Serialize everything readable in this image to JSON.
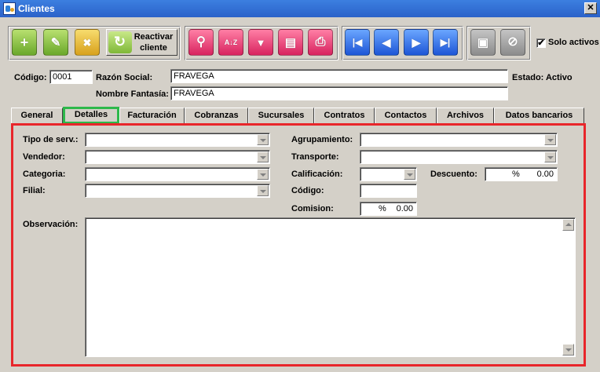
{
  "window": {
    "title": "Clientes",
    "close_glyph": "✕"
  },
  "toolbar": {
    "reactivar_label": "Reactivar cliente",
    "buttons": [
      {
        "name": "add-icon",
        "glyph": "+"
      },
      {
        "name": "edit-icon",
        "glyph": "✎"
      },
      {
        "name": "delete-icon",
        "glyph": "✖"
      },
      {
        "name": "search-icon",
        "glyph": "⚲"
      },
      {
        "name": "sort-az-icon",
        "glyph": "A↓Z"
      },
      {
        "name": "filter-icon",
        "glyph": "▼"
      },
      {
        "name": "report-icon",
        "glyph": "▤"
      },
      {
        "name": "print-icon",
        "glyph": "⎙"
      },
      {
        "name": "first-record-icon",
        "glyph": "|◀"
      },
      {
        "name": "prev-record-icon",
        "glyph": "◀"
      },
      {
        "name": "next-record-icon",
        "glyph": "▶"
      },
      {
        "name": "last-record-icon",
        "glyph": "▶|"
      },
      {
        "name": "save-icon",
        "glyph": "▣"
      },
      {
        "name": "cancel-icon",
        "glyph": "⊘"
      }
    ],
    "solo_activos_label": "Solo activos",
    "solo_activos_checked": "✔"
  },
  "header": {
    "codigo_label": "Código:",
    "codigo_value": "0001",
    "razon_social_label": "Razón Social:",
    "razon_social_value": "FRAVEGA",
    "nombre_fantasia_label": "Nombre Fantasía:",
    "nombre_fantasia_value": "FRAVEGA",
    "estado": "Estado: Activo"
  },
  "tabs": [
    "General",
    "Detalles",
    "Facturación",
    "Cobranzas",
    "Sucursales",
    "Contratos",
    "Contactos",
    "Archivos",
    "Datos bancarios"
  ],
  "active_tab": "Detalles",
  "detalles": {
    "tipo_serv_label": "Tipo de serv.:",
    "vendedor_label": "Vendedor:",
    "categoria_label": "Categoria:",
    "filial_label": "Filial:",
    "agrupamiento_label": "Agrupamiento:",
    "transporte_label": "Transporte:",
    "calificacion_label": "Calificación:",
    "descuento_label": "Descuento:",
    "descuento_symbol": "%",
    "descuento_value": "0.00",
    "codigo_label": "Código:",
    "comision_label": "Comision:",
    "comision_symbol": "%",
    "comision_value": "0.00",
    "observacion_label": "Observación:"
  },
  "colors": {
    "highlight_tab": "#2db84b",
    "highlight_panel": "#e8262b",
    "titlebar": "#316ac5"
  }
}
